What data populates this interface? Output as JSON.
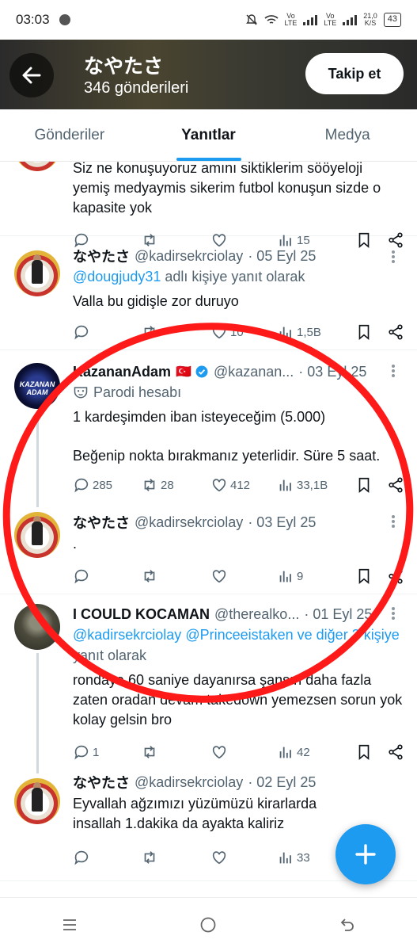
{
  "status_bar": {
    "time": "03:03",
    "net_speed": "21,0",
    "net_unit": "K/S",
    "battery": "43",
    "vo1": "Vo",
    "lte1": "LTE",
    "vo2": "Vo",
    "lte2": "LTE"
  },
  "header": {
    "title": "なやたさ",
    "subtitle": "346 gönderileri",
    "follow_label": "Takip et"
  },
  "tabs": [
    {
      "label": "Gönderiler",
      "active": false
    },
    {
      "label": "Yanıtlar",
      "active": true
    },
    {
      "label": "Medya",
      "active": false
    }
  ],
  "posts": [
    {
      "text_top": "Siz ne konuşuyoruz amını siktiklerim sööyeloji",
      "text": "yemiş medyaymis sikerim futbol konuşun sizde o kapasite yok",
      "views": "15"
    },
    {
      "name": "なやたさ",
      "handle": "@kadirsekrciolay",
      "date": "· 05 Eyl 25",
      "reply_to_link": "@dougjudy31",
      "reply_to_suffix": " adlı kişiye yanıt olarak",
      "text": "Valla bu gidişle zor duruyo",
      "likes": "10",
      "views": "1,5B"
    },
    {
      "name": "KazananAdam",
      "flag": "🇹🇷",
      "handle": "@kazanan...",
      "date": "· 03 Eyl 25",
      "avatar_text": "KAZANAN ADAM",
      "parody_label": "Parodi hesabı",
      "text_line1": "1 kardeşimden iban isteyeceğim (5.000)",
      "text_line2": "Beğenip nokta bırakmanız yeterlidir. Süre 5 saat.",
      "replies": "285",
      "retweets": "28",
      "likes": "412",
      "views": "33,1B"
    },
    {
      "name": "なやたさ",
      "handle": "@kadirsekrciolay",
      "date": "· 03 Eyl 25",
      "text": ".",
      "views": "9"
    },
    {
      "name": "I COULD KOCAMAN",
      "handle": "@therealko...",
      "date": "· 01 Eyl 25",
      "reply_to_link": "@kadirsekrciolay @Princeeistaken ve diğer 3 kişiye",
      "reply_to_suffix": " yanıt olarak",
      "text": "rondaya 60 saniye dayanırsa şansın daha fazla zaten oradan devam takedown yemezsen sorun yok kolay gelsin bro",
      "replies": "1",
      "views": "42"
    },
    {
      "name": "なやたさ",
      "handle": "@kadirsekrciolay",
      "date": "· 02 Eyl 25",
      "text": "Eyvallah ağzımızı yüzümüzü kirarlarda insallah 1.dakika da ayakta kaliriz",
      "views": "33"
    }
  ],
  "colors": {
    "accent": "#1d9bf0",
    "annotation": "#ff1a1a"
  }
}
